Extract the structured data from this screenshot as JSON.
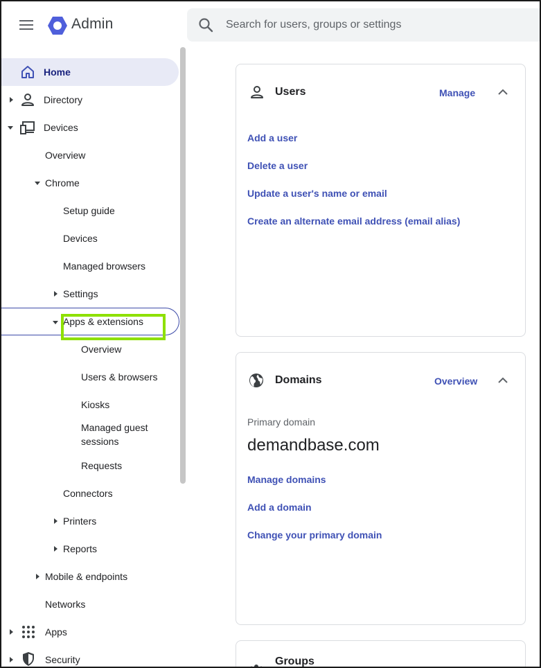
{
  "header": {
    "app_title": "Admin",
    "search_placeholder": "Search for users, groups or settings",
    "brand_color": "#4f5fdb"
  },
  "sidebar": {
    "items": [
      {
        "label": "Home",
        "icon": "home-icon",
        "state": "active"
      },
      {
        "label": "Directory",
        "icon": "person-icon"
      },
      {
        "label": "Devices",
        "icon": "devices-icon",
        "expanded": true
      },
      {
        "label": "Overview"
      },
      {
        "label": "Chrome",
        "expanded": true
      },
      {
        "label": "Setup guide"
      },
      {
        "label": "Devices"
      },
      {
        "label": "Managed browsers"
      },
      {
        "label": "Settings"
      },
      {
        "label": "Apps & extensions",
        "expanded": true,
        "state": "focused"
      },
      {
        "label": "Overview"
      },
      {
        "label": "Users & browsers",
        "state": "highlighted"
      },
      {
        "label": "Kiosks"
      },
      {
        "label": "Managed guest sessions"
      },
      {
        "label": "Requests"
      },
      {
        "label": "Connectors"
      },
      {
        "label": "Printers"
      },
      {
        "label": "Reports"
      },
      {
        "label": "Mobile & endpoints"
      },
      {
        "label": "Networks"
      },
      {
        "label": "Apps",
        "icon": "apps-grid-icon"
      },
      {
        "label": "Security",
        "icon": "shield-icon"
      }
    ]
  },
  "cards": {
    "users": {
      "title": "Users",
      "action": "Manage",
      "links": [
        "Add a user",
        "Delete a user",
        "Update a user's name or email",
        "Create an alternate email address (email alias)"
      ]
    },
    "domains": {
      "title": "Domains",
      "action": "Overview",
      "primary_label": "Primary domain",
      "primary_domain": "demandbase.com",
      "links": [
        "Manage domains",
        "Add a domain",
        "Change your primary domain"
      ]
    },
    "groups": {
      "title": "Groups"
    }
  },
  "colors": {
    "link": "#3f51b5",
    "active_bg": "#e8eaf6",
    "highlight_border": "#8ee000"
  }
}
